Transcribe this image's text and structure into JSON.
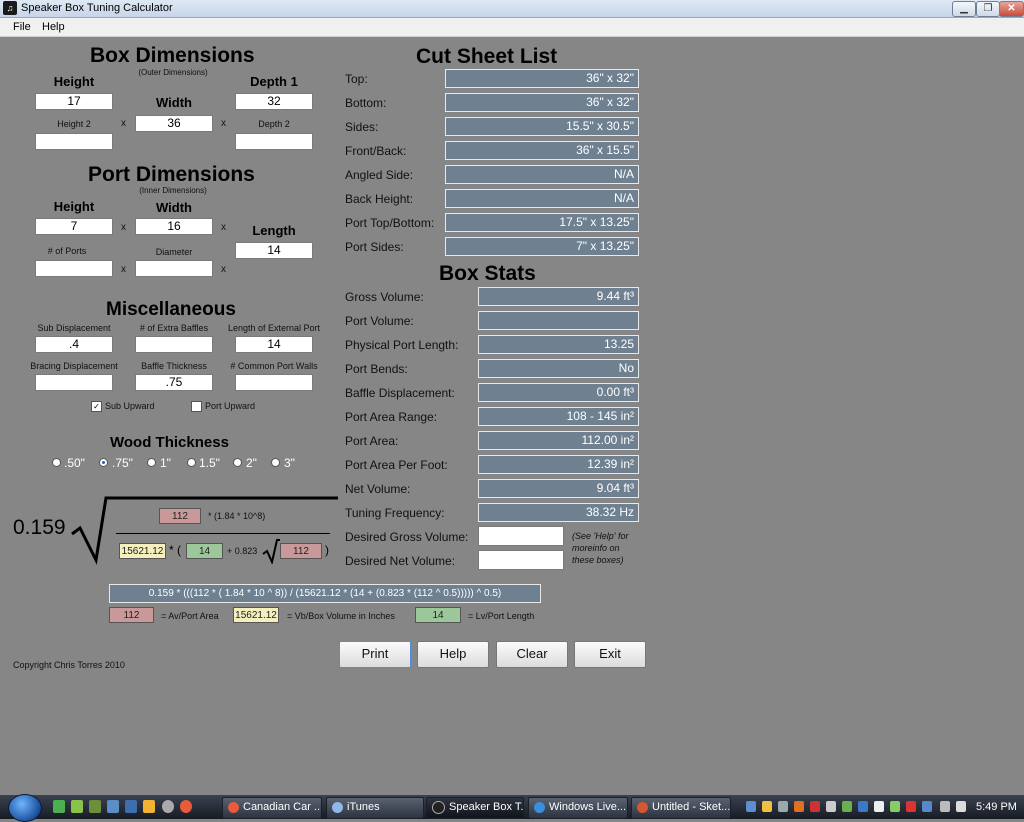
{
  "window": {
    "title": "Speaker Box Tuning Calculator"
  },
  "menu": {
    "file": "File",
    "help": "Help"
  },
  "box_dimensions": {
    "title": "Box Dimensions",
    "subtitle": "(Outer Dimensions)",
    "height_label": "Height",
    "height_value": "17",
    "width_label": "Width",
    "width_value": "36",
    "depth1_label": "Depth 1",
    "depth1_value": "32",
    "height2_label": "Height 2",
    "height2_value": "",
    "depth2_label": "Depth 2",
    "depth2_value": ""
  },
  "port_dimensions": {
    "title": "Port Dimensions",
    "subtitle": "(Inner Dimensions)",
    "height_label": "Height",
    "height_value": "7",
    "width_label": "Width",
    "width_value": "16",
    "length_label": "Length",
    "length_value": "14",
    "num_ports_label": "# of Ports",
    "num_ports_value": "",
    "diameter_label": "Diameter",
    "diameter_value": ""
  },
  "misc": {
    "title": "Miscellaneous",
    "sub_displacement_label": "Sub Displacement",
    "sub_displacement_value": ".4",
    "extra_baffles_label": "# of Extra Baffles",
    "extra_baffles_value": "",
    "ext_port_label": "Length of External Port",
    "ext_port_value": "14",
    "bracing_label": "Bracing Displacement",
    "bracing_value": "",
    "baffle_thickness_label": "Baffle Thickness",
    "baffle_thickness_value": ".75",
    "common_walls_label": "# Common Port Walls",
    "common_walls_value": "",
    "sub_upward_label": "Sub Upward",
    "sub_upward_checked": true,
    "port_upward_label": "Port Upward",
    "port_upward_checked": false
  },
  "wood_thickness": {
    "title": "Wood Thickness",
    "options": [
      ".50\"",
      ".75\"",
      "1\"",
      "1.5\"",
      "2\"",
      "3\""
    ],
    "selected": 1
  },
  "formula": {
    "constant": "0.159",
    "numerator_value": "112",
    "numerator_text": "* (1.84 * 10^8)",
    "vb_value": "15621.12",
    "paren_open": "* (",
    "lv_value": "14",
    "plus_text": "+ 0.823",
    "av_value": "112",
    "paren_close": ")",
    "expression": "0.159 * (((112 * ( 1.84 * 10 ^ 8)) / (15621.12 * (14 + (0.823 * (112 ^ 0.5))))) ^ 0.5)"
  },
  "legend": {
    "av_value": "112",
    "av_text": "= Av/Port Area",
    "vb_value": "15621.12",
    "vb_text": "= Vb/Box Volume in Inches",
    "lv_value": "14",
    "lv_text": "= Lv/Port Length"
  },
  "copyright": "Copyright Chris Torres 2010",
  "cut_sheet": {
    "title": "Cut Sheet List",
    "rows": [
      {
        "label": "Top:",
        "value": "36\" x 32\""
      },
      {
        "label": "Bottom:",
        "value": "36\" x 32\""
      },
      {
        "label": "Sides:",
        "value": "15.5\" x 30.5\""
      },
      {
        "label": "Front/Back:",
        "value": "36\" x 15.5\""
      },
      {
        "label": "Angled Side:",
        "value": "N/A"
      },
      {
        "label": "Back Height:",
        "value": "N/A"
      },
      {
        "label": "Port Top/Bottom:",
        "value": "17.5\" x 13.25\""
      },
      {
        "label": "Port Sides:",
        "value": "7\" x 13.25\""
      }
    ]
  },
  "box_stats": {
    "title": "Box Stats",
    "rows": [
      {
        "label": "Gross Volume:",
        "value": "9.44 ft³"
      },
      {
        "label": "Port Volume:",
        "value": ""
      },
      {
        "label": "Physical Port Length:",
        "value": "13.25"
      },
      {
        "label": "Port Bends:",
        "value": "No"
      },
      {
        "label": "Baffle Displacement:",
        "value": "0.00 ft³"
      },
      {
        "label": "Port Area Range:",
        "value": "108 - 145 in²"
      },
      {
        "label": "Port Area:",
        "value": "112.00 in²"
      },
      {
        "label": "Port Area Per Foot:",
        "value": "12.39 in²"
      },
      {
        "label": "Net Volume:",
        "value": "9.04 ft³"
      },
      {
        "label": "Tuning Frequency:",
        "value": "38.32 Hz"
      }
    ],
    "desired_gross_label": "Desired Gross Volume:",
    "desired_gross_value": "",
    "desired_net_label": "Desired Net Volume:",
    "desired_net_value": "",
    "help_note_1": "(See 'Help' for",
    "help_note_2": "moreinfo on",
    "help_note_3": "these boxes)"
  },
  "buttons": {
    "print": "Print",
    "help": "Help",
    "clear": "Clear",
    "exit": "Exit"
  },
  "taskbar": {
    "tasks": [
      "Canadian Car ...",
      "iTunes",
      "Speaker Box T...",
      "Windows Live...",
      "Untitled - Sket..."
    ],
    "clock": "5:49 PM"
  }
}
